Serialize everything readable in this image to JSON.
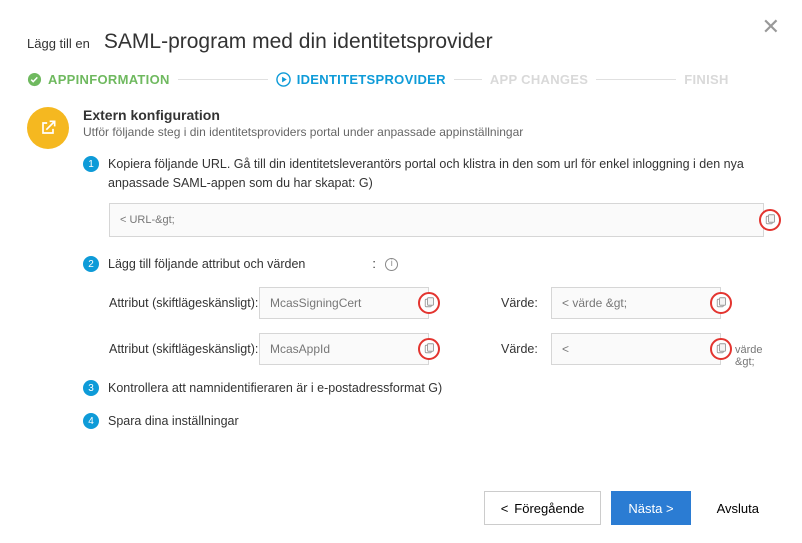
{
  "header": {
    "prefix": "Lägg till en",
    "title": "SAML-program med din identitetsprovider"
  },
  "wizard": {
    "step1": "APPINFORMATION",
    "step2": "IDENTITETSPROVIDER",
    "step3": "APP CHANGES",
    "step4": "FINISH"
  },
  "section": {
    "title": "Extern konfiguration",
    "subtitle": "Utför följande steg i din identitetsproviders portal under anpassade appinställningar"
  },
  "steps": {
    "s1": "Kopiera följande URL. Gå till din identitetsleverantörs portal och klistra in den som url för enkel inloggning i den nya anpassade SAML-appen som du har skapat: G)",
    "url_value": "< URL-&gt;",
    "s2": "Lägg till följande attribut och värden",
    "s2_colon": ":",
    "attr_label": "Attribut (skiftlägeskänsligt):",
    "value_label": "Värde:",
    "attr1": "McasSigningCert",
    "val1": "< värde &gt;",
    "attr2": "McasAppId",
    "val2": "<",
    "overflow": "värde &gt;",
    "s3": "Kontrollera att namnidentifieraren är i e-postadressformat G)",
    "s4": "Spara dina inställningar"
  },
  "buttons": {
    "prev": "Föregående",
    "next": "Nästa >",
    "cancel": "Avsluta"
  }
}
